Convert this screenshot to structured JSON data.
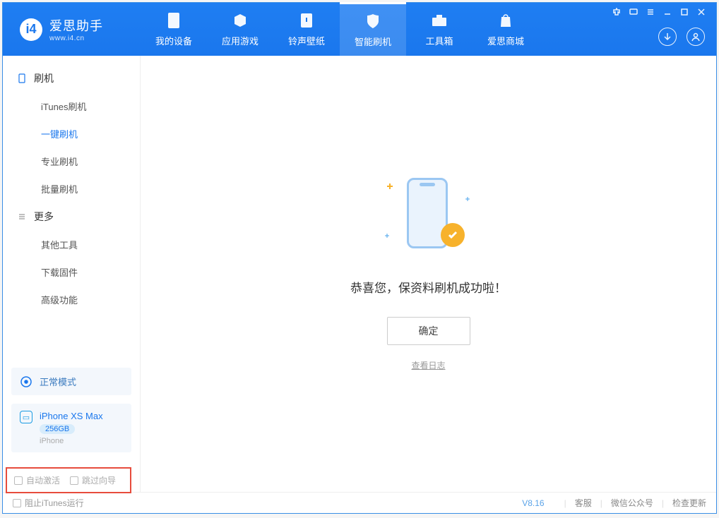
{
  "app": {
    "name": "爱思助手",
    "url": "www.i4.cn"
  },
  "tabs": {
    "device": "我的设备",
    "apps": "应用游戏",
    "ring": "铃声壁纸",
    "flash": "智能刷机",
    "tools": "工具箱",
    "store": "爱思商城"
  },
  "sidebar": {
    "section_flash": "刷机",
    "items_flash": {
      "itunes": "iTunes刷机",
      "onekey": "一键刷机",
      "pro": "专业刷机",
      "batch": "批量刷机"
    },
    "section_more": "更多",
    "items_more": {
      "other": "其他工具",
      "firmware": "下载固件",
      "adv": "高级功能"
    }
  },
  "mode": {
    "label": "正常模式"
  },
  "device": {
    "name": "iPhone XS Max",
    "capacity": "256GB",
    "type": "iPhone"
  },
  "main": {
    "success": "恭喜您，保资料刷机成功啦！",
    "ok": "确定",
    "log": "查看日志"
  },
  "options": {
    "auto_activate": "自动激活",
    "skip_guide": "跳过向导"
  },
  "footer": {
    "block_itunes": "阻止iTunes运行",
    "version": "V8.16",
    "support": "客服",
    "wechat": "微信公众号",
    "update": "检查更新"
  }
}
